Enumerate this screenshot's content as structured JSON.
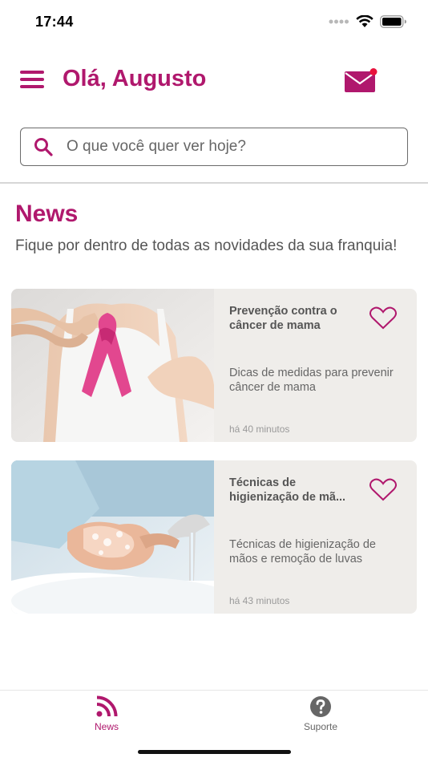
{
  "status_bar": {
    "time": "17:44"
  },
  "header": {
    "greeting": "Olá, Augusto"
  },
  "search": {
    "placeholder": "O que você quer ver hoje?"
  },
  "news_section": {
    "title": "News",
    "subtitle": "Fique por dentro de todas as novidades da sua franquia!"
  },
  "cards": [
    {
      "title": "Prevenção contra o câncer de mama",
      "description": "Dicas de medidas para prevenir câncer de mama",
      "time": "há 40 minutos",
      "image_icon": "pink-ribbon-photo"
    },
    {
      "title_line1": "Técnicas de",
      "title_line2": "higienização de mã...",
      "description": "Técnicas de higienização de mãos e remoção de luvas",
      "time": "há 43 minutos",
      "image_icon": "hand-washing-photo"
    }
  ],
  "tab_bar": {
    "tabs": [
      {
        "label": "News",
        "icon": "rss-icon",
        "active": true
      },
      {
        "label": "Suporte",
        "icon": "help-circle-icon",
        "active": false
      }
    ]
  },
  "colors": {
    "brand": "#b0186d",
    "card_bg": "#efedea",
    "notification_dot": "#e8123c"
  }
}
